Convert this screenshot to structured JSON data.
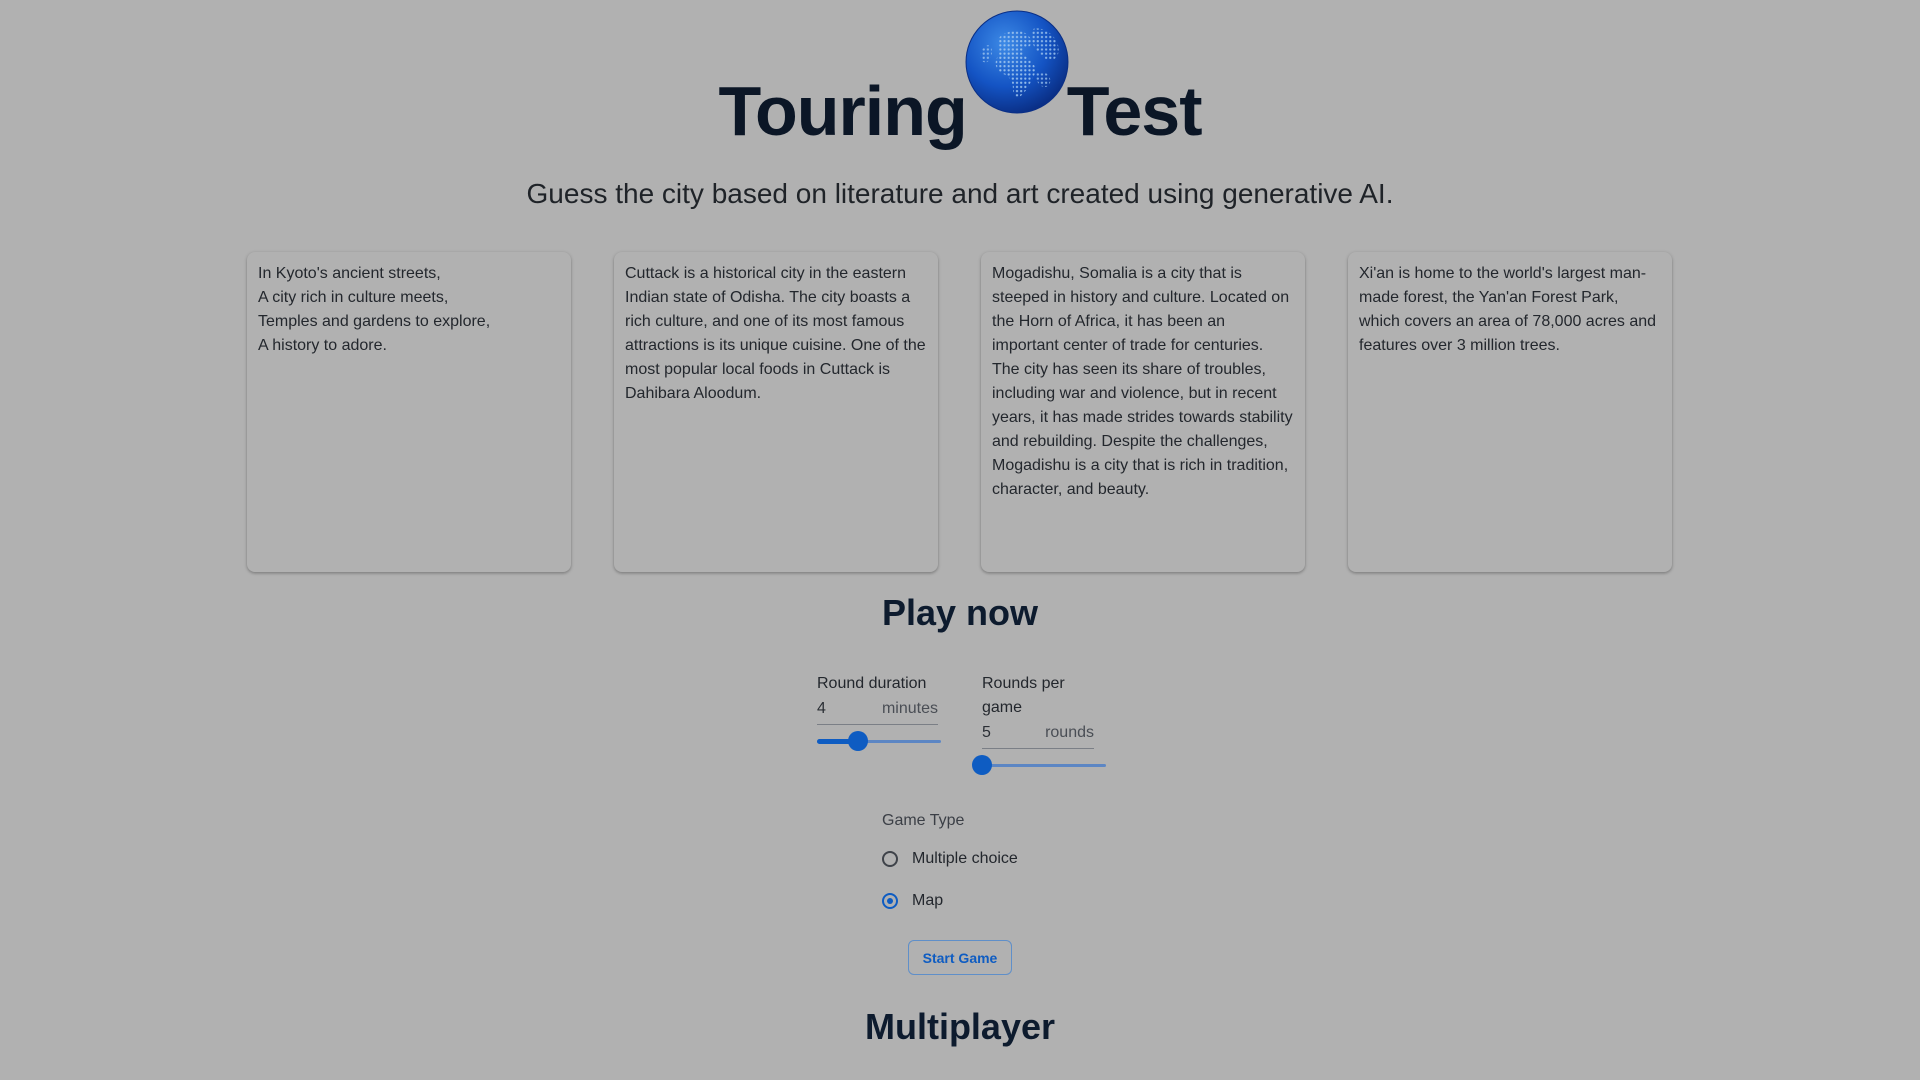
{
  "header": {
    "logo_left": "Touring",
    "logo_right": "Test",
    "logo_icon": "globe-icon",
    "tagline": "Guess the city based on literature and art created using generative AI."
  },
  "cards": [
    {
      "text": "In Kyoto's ancient streets,\nA city rich in culture meets,\nTemples and gardens to explore,\nA history to adore."
    },
    {
      "text": "Cuttack is a historical city in the eastern Indian state of Odisha. The city boasts a rich culture, and one of its most famous attractions is its unique cuisine. One of the most popular local foods in Cuttack is Dahibara Aloodum."
    },
    {
      "text": "Mogadishu, Somalia is a city that is steeped in history and culture. Located on the Horn of Africa, it has been an important center of trade for centuries. The city has seen its share of troubles, including war and violence, but in recent years, it has made strides towards stability and rebuilding. Despite the challenges, Mogadishu is a city that is rich in tradition, character, and beauty."
    },
    {
      "text": "Xi'an is home to the world's largest man-made forest, the Yan'an Forest Park, which covers an area of 78,000 acres and features over 3 million trees."
    }
  ],
  "play": {
    "title": "Play now",
    "round_duration": {
      "label": "Round duration",
      "value": "4",
      "unit": "minutes",
      "slider_fraction": 0.33
    },
    "rounds_per_game": {
      "label": "Rounds per game",
      "value": "5",
      "unit": "rounds",
      "slider_fraction": 0.0
    },
    "game_type": {
      "label": "Game Type",
      "options": [
        "Multiple choice",
        "Map"
      ],
      "selected": "Map"
    },
    "start_label": "Start Game"
  },
  "multiplayer": {
    "title": "Multiplayer"
  },
  "colors": {
    "background": "#b1b1b1",
    "accent": "#0e5cc2",
    "heading": "#0d1b2e"
  }
}
